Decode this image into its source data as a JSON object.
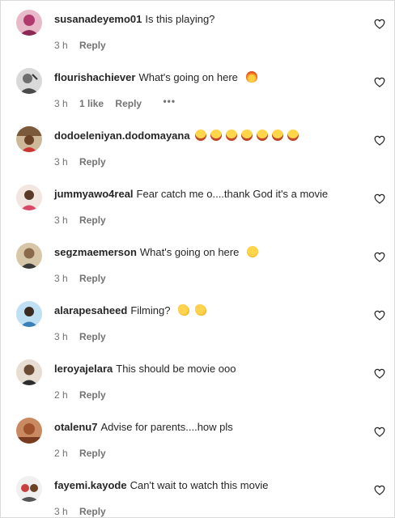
{
  "comments": [
    {
      "username": "susanadeyemo01",
      "text": "Is this playing?",
      "emojis": [],
      "time": "3 h",
      "likes": "",
      "reply": "Reply",
      "more": "",
      "avatar_color": "#b03a6d"
    },
    {
      "username": "flourishachiever",
      "text": "What's going on here",
      "emojis": [
        "fire-emoji"
      ],
      "time": "3 h",
      "likes": "1 like",
      "reply": "Reply",
      "more": "•••",
      "avatar_color": "#6e6e6e"
    },
    {
      "username": "dodoeleniyan.dodomayana",
      "text": "",
      "emojis": [
        "laugh-emoji",
        "laugh-emoji",
        "laugh-emoji",
        "laugh-emoji",
        "laugh-emoji",
        "laugh-emoji",
        "laugh-emoji"
      ],
      "time": "3 h",
      "likes": "",
      "reply": "Reply",
      "more": "",
      "avatar_color": "#7a5a3a"
    },
    {
      "username": "jummyawo4real",
      "text": "Fear catch me o....thank God it's a movie",
      "emojis": [],
      "time": "3 h",
      "likes": "",
      "reply": "Reply",
      "more": "",
      "avatar_color": "#5a3b2a"
    },
    {
      "username": "segzmaemerson",
      "text": "What's going on here",
      "emojis": [
        "thinking-emoji"
      ],
      "time": "3 h",
      "likes": "",
      "reply": "Reply",
      "more": "",
      "avatar_color": "#8a6a4a"
    },
    {
      "username": "alarapesaheed",
      "text": "Filming?",
      "emojis": [
        "clap-emoji",
        "clap-emoji"
      ],
      "time": "3 h",
      "likes": "",
      "reply": "Reply",
      "more": "",
      "avatar_color": "#3a7fb5"
    },
    {
      "username": "leroyajelara",
      "text": "This should be movie ooo",
      "emojis": [],
      "time": "2 h",
      "likes": "",
      "reply": "Reply",
      "more": "",
      "avatar_color": "#6b4a35"
    },
    {
      "username": "otalenu7",
      "text": "Advise for parents....how pls",
      "emojis": [],
      "time": "2 h",
      "likes": "",
      "reply": "Reply",
      "more": "",
      "avatar_color": "#a0522d"
    },
    {
      "username": "fayemi.kayode",
      "text": "Can't wait to watch this movie",
      "emojis": [],
      "time": "3 h",
      "likes": "",
      "reply": "Reply",
      "more": "",
      "avatar_color": "#c94040"
    }
  ]
}
